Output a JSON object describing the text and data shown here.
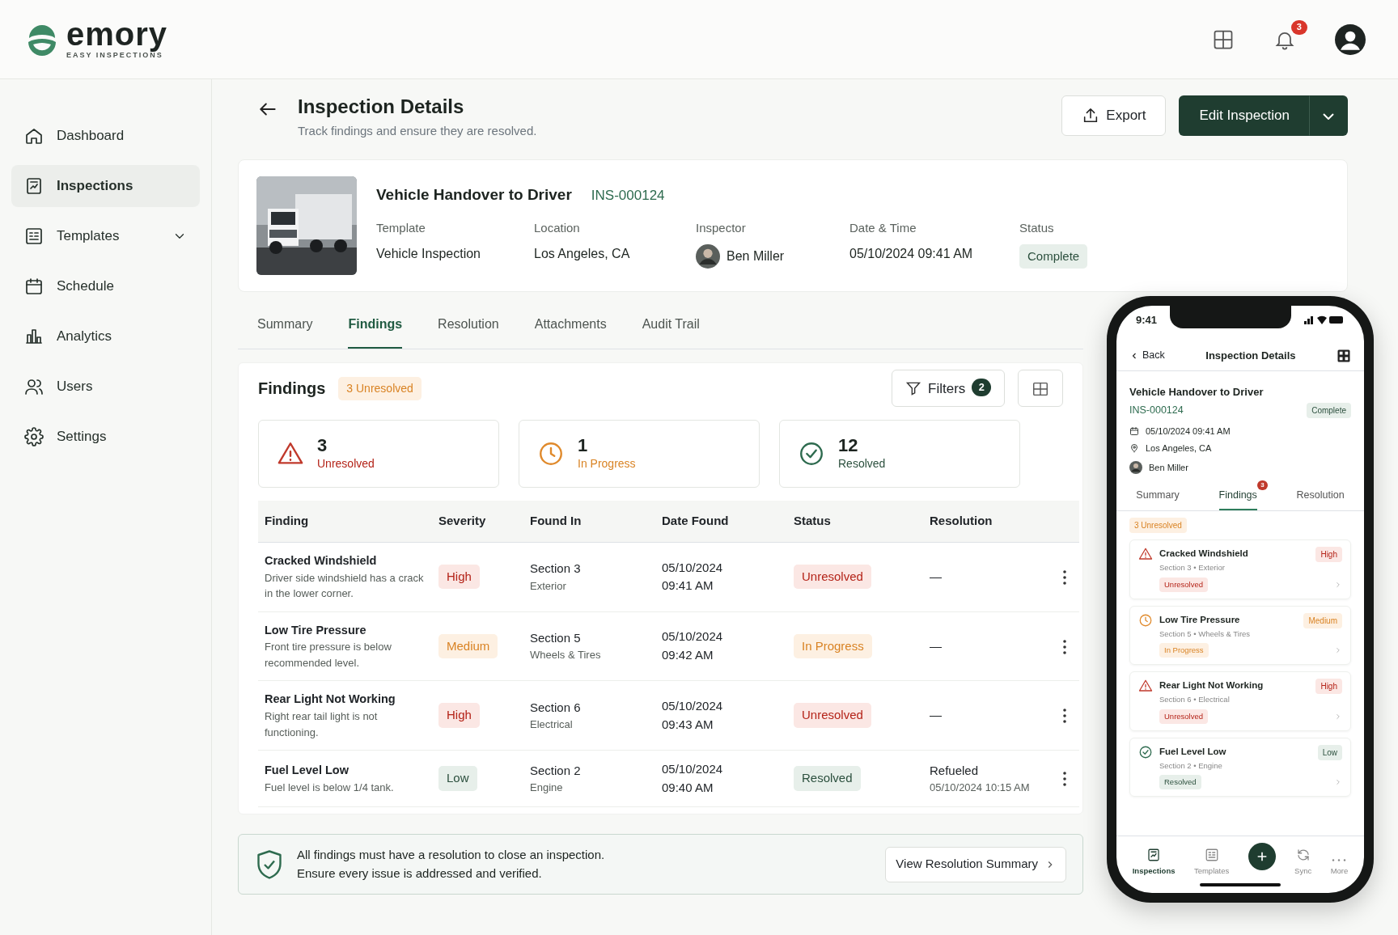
{
  "brand": {
    "name": "emory",
    "tagline": "EASY INSPECTIONS"
  },
  "topbar": {
    "notifications": "3"
  },
  "sidebar": {
    "items": [
      {
        "label": "Dashboard",
        "selected": false,
        "expandable": false
      },
      {
        "label": "Inspections",
        "selected": true,
        "expandable": false
      },
      {
        "label": "Templates",
        "selected": false,
        "expandable": true
      },
      {
        "label": "Schedule",
        "selected": false,
        "expandable": false
      },
      {
        "label": "Analytics",
        "selected": false,
        "expandable": false
      },
      {
        "label": "Users",
        "selected": false,
        "expandable": false
      },
      {
        "label": "Settings",
        "selected": false,
        "expandable": false
      }
    ]
  },
  "page": {
    "title": "Inspection Details",
    "subtitle": "Track findings and ensure they are resolved.",
    "export": "Export",
    "edit": "Edit Inspection"
  },
  "inspection": {
    "title": "Vehicle Handover to Driver",
    "id": "INS-000124",
    "fields": [
      {
        "label": "Template",
        "value": "Vehicle Inspection",
        "kind": "text"
      },
      {
        "label": "Location",
        "value": "Los Angeles, CA",
        "kind": "text"
      },
      {
        "label": "Inspector",
        "value": "Ben Miller",
        "kind": "person"
      },
      {
        "label": "Date & Time",
        "value": "05/10/2024 09:41 AM",
        "kind": "text"
      },
      {
        "label": "Status",
        "value": "Complete",
        "kind": "badge"
      }
    ]
  },
  "tabs": [
    {
      "label": "Summary",
      "selected": false
    },
    {
      "label": "Findings",
      "selected": true
    },
    {
      "label": "Resolution",
      "selected": false
    },
    {
      "label": "Attachments",
      "selected": false
    },
    {
      "label": "Audit Trail",
      "selected": false
    }
  ],
  "findings": {
    "title": "Findings",
    "badge": "3 Unresolved",
    "filters": "Filters",
    "filter_count": "2",
    "stats": [
      {
        "value": "3",
        "label": "Unresolved",
        "kind": "unresolved"
      },
      {
        "value": "1",
        "label": "In Progress",
        "kind": "progress"
      },
      {
        "value": "12",
        "label": "Resolved",
        "kind": "resolved"
      }
    ],
    "table": {
      "columns": [
        "Finding",
        "Severity",
        "Found In",
        "Date Found",
        "Status",
        "Resolution"
      ],
      "rows": [
        {
          "title": "Cracked Windshield",
          "description": "Driver side windshield has a crack in the lower corner.",
          "severity": {
            "text": "High",
            "kind": "danger"
          },
          "section": "Section 3",
          "area": "Exterior",
          "date": "05/10/2024",
          "time": "09:41 AM",
          "status": {
            "text": "Unresolved",
            "kind": "danger"
          },
          "resolution": "—"
        },
        {
          "title": "Low Tire Pressure",
          "description": "Front tire pressure is below recommended level.",
          "severity": {
            "text": "Medium",
            "kind": "warning"
          },
          "section": "Section 5",
          "area": "Wheels & Tires",
          "date": "05/10/2024",
          "time": "09:42 AM",
          "status": {
            "text": "In Progress",
            "kind": "warning"
          },
          "resolution": "—"
        },
        {
          "title": "Rear Light Not Working",
          "description": "Right rear tail light is not functioning.",
          "severity": {
            "text": "High",
            "kind": "danger"
          },
          "section": "Section 6",
          "area": "Electrical",
          "date": "05/10/2024",
          "time": "09:43 AM",
          "status": {
            "text": "Unresolved",
            "kind": "danger"
          },
          "resolution": "—"
        },
        {
          "title": "Fuel Level Low",
          "description": "Fuel level is below 1/4 tank.",
          "severity": {
            "text": "Low",
            "kind": "success"
          },
          "section": "Section 2",
          "area": "Engine",
          "date": "05/10/2024",
          "time": "09:40 AM",
          "status": {
            "text": "Resolved",
            "kind": "success"
          },
          "resolution": "Refueled",
          "resolution_date": "05/10/2024 10:15 AM"
        }
      ]
    }
  },
  "notice": {
    "lines": [
      "All findings must have a resolution to close an inspection.",
      "Ensure every issue is addressed and verified."
    ],
    "button": "View Resolution Summary"
  },
  "phone": {
    "time": "9:41",
    "back": "Back",
    "title": "Inspection Details",
    "inspection": "Vehicle Handover to Driver",
    "id": "INS-000124",
    "status": "Complete",
    "date": "05/10/2024 09:41 AM",
    "location": "Los Angeles, CA",
    "inspector": "Ben Miller",
    "tabs": [
      {
        "label": "Summary",
        "selected": false
      },
      {
        "label": "Findings",
        "selected": true,
        "count": "3"
      },
      {
        "label": "Resolution",
        "selected": false
      }
    ],
    "badge": "3 Unresolved",
    "findings": [
      {
        "title": "Cracked Windshield",
        "meta": "Section 3 • Exterior",
        "kind": "unresolved",
        "severity": {
          "text": "High",
          "kind": "danger"
        },
        "status": {
          "text": "Unresolved",
          "kind": "danger"
        }
      },
      {
        "title": "Low Tire Pressure",
        "meta": "Section 5 • Wheels & Tires",
        "kind": "progress",
        "severity": {
          "text": "Medium",
          "kind": "warning"
        },
        "status": {
          "text": "In Progress",
          "kind": "warning"
        }
      },
      {
        "title": "Rear Light Not Working",
        "meta": "Section 6 • Electrical",
        "kind": "unresolved",
        "severity": {
          "text": "High",
          "kind": "danger"
        },
        "status": {
          "text": "Unresolved",
          "kind": "danger"
        }
      },
      {
        "title": "Fuel Level Low",
        "meta": "Section 2 • Engine",
        "kind": "resolved",
        "severity": {
          "text": "Low",
          "kind": "success"
        },
        "status": {
          "text": "Resolved",
          "kind": "success"
        }
      }
    ],
    "nav": [
      {
        "label": "Inspections",
        "selected": true
      },
      {
        "label": "Templates",
        "selected": false
      },
      {
        "label": "Sync",
        "selected": false
      },
      {
        "label": "More",
        "selected": false
      }
    ]
  }
}
